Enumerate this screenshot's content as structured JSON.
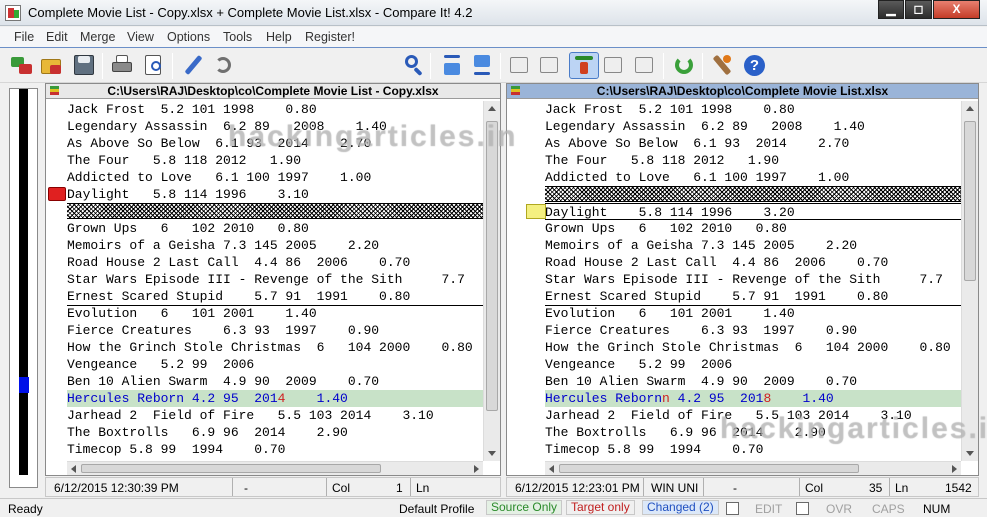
{
  "window": {
    "title": "Complete Movie List - Copy.xlsx + Complete Movie List.xlsx - Compare It! 4.2",
    "min": "▁",
    "max": "◻",
    "close": "X"
  },
  "menu": [
    "File",
    "Edit",
    "Merge",
    "View",
    "Options",
    "Tools",
    "Help",
    "Register!"
  ],
  "toolbar": {
    "search_value": "",
    "icons": [
      "open-files-icon",
      "open-folder-icon",
      "save-icon",
      "print-icon",
      "print-preview-icon",
      "edit-icon",
      "undo-icon",
      "search-icon",
      "first-difference-icon",
      "last-difference-icon",
      "copy-right-icon",
      "copy-all-right-icon",
      "next-difference-icon",
      "copy-left-icon",
      "copy-all-left-icon",
      "refresh-icon",
      "settings-icon",
      "help-icon"
    ]
  },
  "left_pane": {
    "path": "C:\\Users\\RAJ\\Desktop\\co\\Complete Movie List - Copy.xlsx",
    "lines": [
      "Jack Frost  5.2 101 1998    0.80",
      "Legendary Assassin  6.2 89   2008    1.40",
      "As Above So Below  6.1 93  2014    2.70",
      "The Four   5.8 118 2012   1.90",
      "Addicted to Love   6.1 100 1997    1.00",
      "Daylight   5.8 114 1996    3.10",
      "",
      "Grown Ups   6   102 2010   0.80",
      "Memoirs of a Geisha 7.3 145 2005    2.20",
      "Road House 2 Last Call  4.4 86  2006    0.70",
      "Star Wars Episode III - Revenge of the Sith     7.7",
      "Ernest Scared Stupid    5.7 91  1991    0.80",
      "Evolution   6   101 2001    1.40",
      "Fierce Creatures    6.3 93  1997    0.90",
      "How the Grinch Stole Christmas  6   104 2000    0.80",
      "Vengeance   5.2 99  2006",
      "Ben 10 Alien Swarm  4.9 90  2009    0.70",
      "Hercules Reborn 4.2 95  2014    1.40",
      "Jarhead 2  Field of Fire   5.5 103 2014    3.10",
      "The Boxtrolls   6.9 96  2014    2.90",
      "Timecop 5.8 99  1994    0.70"
    ],
    "hl_pre": "Hercules Reborn 4.2 95  201",
    "hl_diff": "4",
    "hl_post": "    1.40",
    "status": {
      "date": "6/12/2015 12:30:39 PM",
      "enc": "-",
      "col_label": "Col",
      "col": "1",
      "ln_label": "Ln"
    }
  },
  "right_pane": {
    "path": "C:\\Users\\RAJ\\Desktop\\co\\Complete Movie List.xlsx",
    "lines": [
      "Jack Frost  5.2 101 1998    0.80",
      "Legendary Assassin  6.2 89   2008    1.40",
      "As Above So Below  6.1 93  2014    2.70",
      "The Four   5.8 118 2012   1.90",
      "Addicted to Love   6.1 100 1997    1.00",
      "",
      "Daylight    5.8 114 1996    3.20",
      "Grown Ups   6   102 2010   0.80",
      "Memoirs of a Geisha 7.3 145 2005    2.20",
      "Road House 2 Last Call  4.4 86  2006    0.70",
      "Star Wars Episode III - Revenge of the Sith     7.7",
      "Ernest Scared Stupid    5.7 91  1991    0.80",
      "Evolution   6   101 2001    1.40",
      "Fierce Creatures    6.3 93  1997    0.90",
      "How the Grinch Stole Christmas  6   104 2000    0.80",
      "Vengeance   5.2 99  2006",
      "Ben 10 Alien Swarm  4.9 90  2009    0.70",
      "Hercules Reborn 4.2 95  2018    1.40",
      "Jarhead 2  Field of Fire   5.5 103 2014    3.10",
      "The Boxtrolls   6.9 96  2014    2.90",
      "Timecop 5.8 99  1994    0.70"
    ],
    "hl_pre": "Hercules Reborn",
    "hl_diff1": "n",
    "hl_mid": " 4.2 95  201",
    "hl_diff2": "8",
    "hl_post": "    1.40",
    "status": {
      "date": "6/12/2015 12:23:01 PM",
      "enc": "WIN UNI",
      "col_label": "Col",
      "col": "35",
      "ln_label": "Ln",
      "ln": "1542"
    }
  },
  "watermark": "hackingarticles.in",
  "statusbar": {
    "ready": "Ready",
    "profile": "Default Profile",
    "source_only": "Source Only",
    "target_only": "Target only",
    "changed": "Changed (2)",
    "edit": "EDIT",
    "ovr": "OVR",
    "caps": "CAPS",
    "num": "NUM"
  },
  "colors": {
    "source_only": "#2a8a2a",
    "target_only": "#c02020",
    "changed": "#2050c0",
    "hl_row": "#c8e2c8",
    "mapper_mark": "#0010e8"
  }
}
